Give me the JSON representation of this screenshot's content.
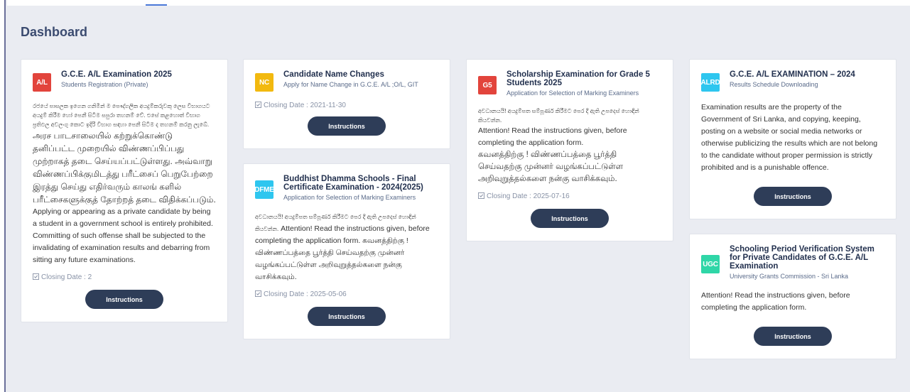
{
  "page": {
    "title": "Dashboard"
  },
  "cards": [
    {
      "id": "gce_al_2025",
      "badge": "A/L",
      "badge_color": "#e2443c",
      "title": "G.C.E. A/L Examination 2025",
      "subtitle": "Students Registration (Private)",
      "body_si": "රජයේ පාසලක ඉගෙන ගනිමින් ම පෞද්ගලික අයදුම්කරුවකු ලෙස විභාගයට අයදුම් කිරීම හෝ පෙනී සිටීම සපුරා තහනම් වේ. එසේ කළහොත් විභාග ප්‍රතිඵල අවලංගු කොට ඉදිරි විභාග සඳහා පෙනී සිටීම ද තහනම් කරනු ලැබේ.",
      "body_ta": "அரச பாடசாலையில் கற்றுக்கொண்டு தனிப்பட்ட முறையில் விண்ணப்பிப்பது முற்றாகத் தடை செய்யப்பட்டுள்ளது. அவ்வாறு விண்ணப்பிக்குமிடத்து பரீட்சைப் பெறுபேற்றை இரத்து செய்து எதிர்வரும் காலங் களில் பரீட்சைகளுக்குத் தோற்றத் தடை விதிக்கப்படும்.",
      "body_en": "Applying or appearing as a private candidate by being a student in a government school is entirely prohibited. Committing of such offense shall be subjected to the invalidating of examination results and debarring from sitting any future examinations.",
      "closing": "Closing Date : 2",
      "button": "Instructions"
    },
    {
      "id": "name_changes",
      "badge": "NC",
      "badge_color": "#f2b90f",
      "title": "Candidate Name Changes",
      "subtitle": "Apply for Name Change in G.C.E. A/L ;O/L, GIT",
      "closing": "Closing Date : 2021-11-30",
      "button": "Instructions"
    },
    {
      "id": "dhamma_schools",
      "badge": "DFME",
      "badge_color": "#2ec6ef",
      "title": "Buddhist Dhamma Schools - Final Certificate Examination - 2024(2025)",
      "subtitle": "Application for Selection of Marking Examiners",
      "body_si": "අවධානයයි! අයදුම්පත සම්පූර්ණ කිරීමට පෙර දී ඇති උපදෙස් හොඳින් කියවන්න.",
      "body_en": "Attention! Read the instructions given, before completing the application form.",
      "body_ta": "கவனத்திற்கு ! விண்ணப்பத்தை பூர்த்தி செய்வதற்கு முன்னர் வழங்கப்பட்டுள்ள அறிவுறுத்தல்களை நன்கு வாசிக்கவும்.",
      "closing": "Closing Date : 2025-05-06",
      "button": "Instructions"
    },
    {
      "id": "scholarship_g5",
      "badge": "G5",
      "badge_color": "#e2443c",
      "title": "Scholarship Examination for Grade 5 Students 2025",
      "subtitle": "Application for Selection of Marking Examiners",
      "body_si": "අවධානයයි! අයදුම්පත සම්පූර්ණ කිරීමට පෙර දී ඇති උපදෙස් හොඳින් කියවන්න.",
      "body_en": "Attention! Read the instructions given, before completing the application form.",
      "body_ta": "கவனத்திற்கு ! விண்ணப்பத்தை பூர்த்தி செய்வதற்கு முன்னர் வழங்கப்பட்டுள்ள அறிவுறுத்தல்களை நன்கு வாசிக்கவும்.",
      "closing": "Closing Date : 2025-07-16",
      "button": "Instructions"
    },
    {
      "id": "al_results_2024",
      "badge": "ALRD",
      "badge_color": "#2ec6ef",
      "title": "G.C.E. A/L EXAMINATION – 2024",
      "subtitle": "Results Schedule Downloading",
      "body_en": "Examination results are the property of the Government of Sri Lanka, and copying, keeping, posting on a website or social media networks or otherwise publicizing the results which are not belong to the candidate without proper permission is strictly prohibited and is a punishable offence.",
      "button": "Instructions"
    },
    {
      "id": "ugc",
      "badge": "UGC",
      "badge_color": "#2fd6a7",
      "title": "Schooling Period Verification System for Private Candidates of G.C.E. A/L Examination",
      "subtitle": "University Grants Commission - Sri Lanka",
      "body_en": "Attention! Read the instructions given, before completing the application form.",
      "button": "Instructions"
    }
  ]
}
